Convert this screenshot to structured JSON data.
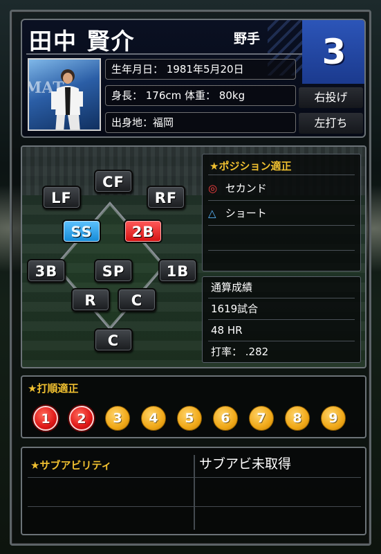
{
  "player": {
    "name": "田中 賢介",
    "role": "野手",
    "number": "3",
    "birthdate": "生年月日： 1981年5月20日",
    "body": "身長： 176cm 体重： 80kg",
    "hometown": "出身地：福岡",
    "throws": "右投げ",
    "bats": "左打ち"
  },
  "positions": {
    "cf": "CF",
    "lf": "LF",
    "rf": "RF",
    "ss": "SS",
    "second": "2B",
    "third": "3B",
    "sp": "SP",
    "first": "1B",
    "rp": "R",
    "closer": "C",
    "catcher": "C"
  },
  "aptitude": {
    "title": "★ポジション適正",
    "items": [
      {
        "mark": "◎",
        "label": "セカンド"
      },
      {
        "mark": "△",
        "label": "ショート"
      }
    ]
  },
  "record": {
    "title": "通算成績",
    "games": "1619試合",
    "hr": "48 HR",
    "avg": "打率： .282"
  },
  "batting_order": {
    "title": "★打順適正",
    "slots": [
      {
        "label": "1",
        "active": true
      },
      {
        "label": "2",
        "active": true
      },
      {
        "label": "3",
        "active": false
      },
      {
        "label": "4",
        "active": false
      },
      {
        "label": "5",
        "active": false
      },
      {
        "label": "6",
        "active": false
      },
      {
        "label": "7",
        "active": false
      },
      {
        "label": "8",
        "active": false
      },
      {
        "label": "9",
        "active": false
      }
    ]
  },
  "sub_ability": {
    "title": "★サブアビリティ",
    "status": "サブアビ未取得"
  },
  "colors": {
    "accent_gold": "#f0c030",
    "active_red": "#e01818",
    "inactive_orange": "#f0a818",
    "ss_blue": "#1389d6",
    "number_blue": "#2c55b8"
  },
  "photo_text": "MAT"
}
